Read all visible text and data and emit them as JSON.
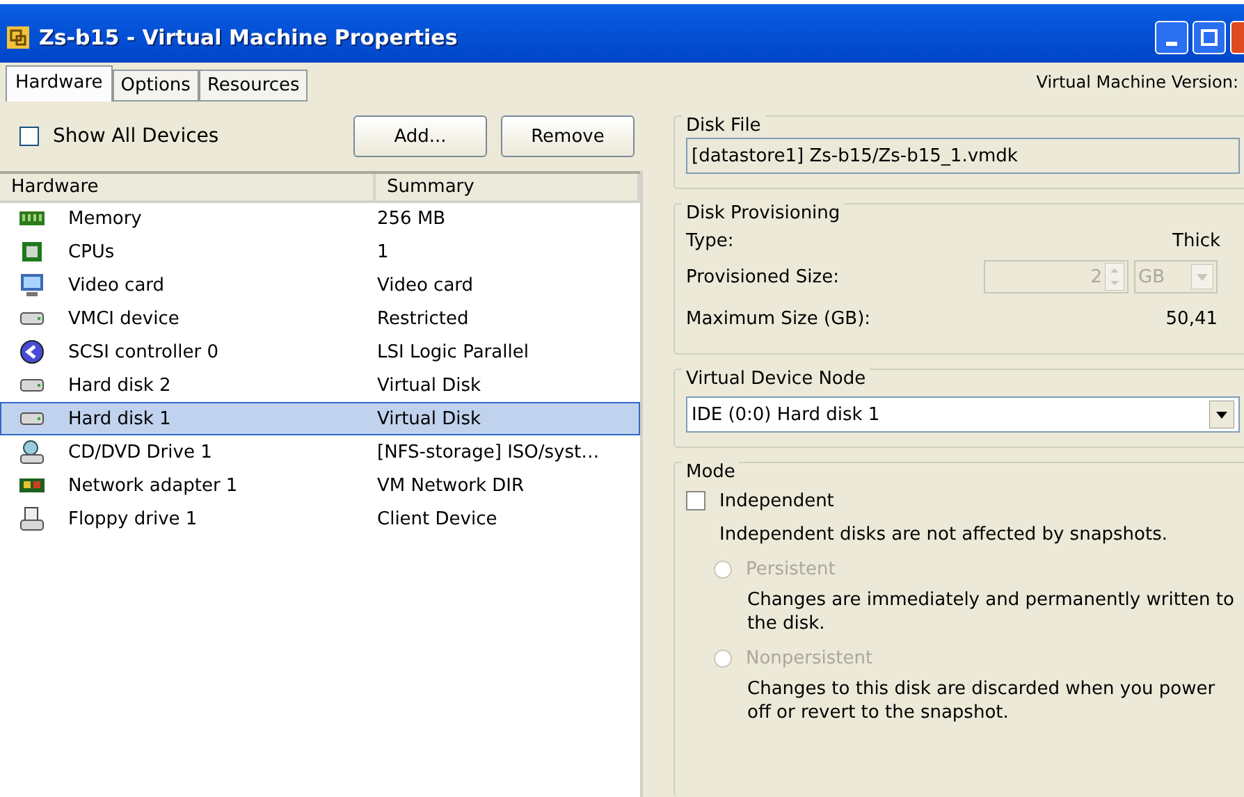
{
  "window": {
    "title": "Zs-b15 - Virtual Machine Properties"
  },
  "tabs": [
    {
      "label": "Hardware",
      "selected": true
    },
    {
      "label": "Options",
      "selected": false
    },
    {
      "label": "Resources",
      "selected": false
    }
  ],
  "version_label": "Virtual Machine Version:",
  "toolbar": {
    "show_all": {
      "label": "Show All Devices",
      "checked": false
    },
    "buttons": [
      "Add...",
      "Remove"
    ]
  },
  "table": {
    "columns": [
      "Hardware",
      "Summary"
    ],
    "rows": [
      {
        "kind": "memory",
        "name": "Memory",
        "summary": "256 MB",
        "selected": false
      },
      {
        "kind": "cpu",
        "name": "CPUs",
        "summary": "1",
        "selected": false
      },
      {
        "kind": "video",
        "name": "Video card",
        "summary": "Video card",
        "selected": false
      },
      {
        "kind": "drive",
        "name": "VMCI device",
        "summary": "Restricted",
        "selected": false
      },
      {
        "kind": "scsi",
        "name": "SCSI controller 0",
        "summary": "LSI Logic Parallel",
        "selected": false
      },
      {
        "kind": "drive",
        "name": "Hard disk 2",
        "summary": "Virtual Disk",
        "selected": false
      },
      {
        "kind": "drive",
        "name": "Hard disk 1",
        "summary": "Virtual Disk",
        "selected": true
      },
      {
        "kind": "cdrom",
        "name": "CD/DVD Drive 1",
        "summary": "[NFS-storage] ISO/syst…",
        "selected": false
      },
      {
        "kind": "network",
        "name": "Network adapter 1",
        "summary": "VM Network DIR",
        "selected": false
      },
      {
        "kind": "floppy",
        "name": "Floppy drive 1",
        "summary": "Client Device",
        "selected": false
      }
    ]
  },
  "disk_file": {
    "title": "Disk File",
    "value": "[datastore1] Zs-b15/Zs-b15_1.vmdk"
  },
  "disk_provisioning": {
    "title": "Disk Provisioning",
    "type_label": "Type:",
    "type_value": "Thick",
    "size_label": "Provisioned Size:",
    "size_value": "2",
    "size_disabled": true,
    "unit": "GB",
    "max_label": "Maximum Size (GB):",
    "max_value": "50,41"
  },
  "device_node": {
    "title": "Virtual Device Node",
    "value": "IDE (0:0) Hard disk 1"
  },
  "mode": {
    "title": "Mode",
    "independent": {
      "label": "Independent",
      "checked": false
    },
    "note": "Independent disks are not affected by snapshots.",
    "options": [
      {
        "label": "Persistent",
        "selected": false,
        "disabled": true,
        "description": "Changes are immediately and permanently written to the disk."
      },
      {
        "label": "Nonpersistent",
        "selected": false,
        "disabled": true,
        "description": "Changes to this disk are discarded when you power off or revert to the snapshot."
      }
    ]
  }
}
